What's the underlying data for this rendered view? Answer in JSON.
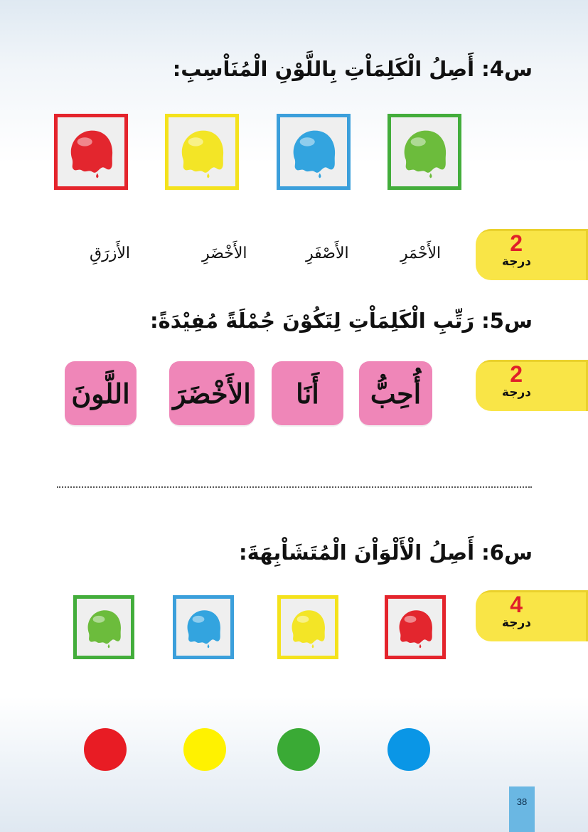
{
  "questions": {
    "q4": {
      "title": "س4: أَصِلُ الْكَلِمَاْتِ بِاللَّوْنِ الْمُنَاْسِبِ:",
      "grade_number": "2",
      "grade_word": "درجة",
      "cards": [
        {
          "color_name": "red",
          "border": "#e4242c",
          "fill": "#e3262e"
        },
        {
          "color_name": "yellow",
          "border": "#f4e21c",
          "fill": "#f3e526"
        },
        {
          "color_name": "blue",
          "border": "#3b9fdb",
          "fill": "#33a4df"
        },
        {
          "color_name": "green",
          "border": "#43ad3b",
          "fill": "#6cbc3c"
        }
      ],
      "words": [
        "الأَزرَقِ",
        "الأَخْضَرِ",
        "الأَصْفَرِ",
        "الأَحْمَرِ"
      ]
    },
    "q5": {
      "title": "س5: رَتِّبِ الْكَلِمَاْتِ لِتَكُوْنَ جُمْلَةً مُفِيْدَةً:",
      "grade_number": "2",
      "grade_word": "درجة",
      "tiles": [
        "اللَّونَ",
        "الأَخْضَرَ",
        "أَنَا",
        "أُحِبُّ"
      ]
    },
    "q6": {
      "title": "س6: أَصِلُ الْأَلْوَاْنَ الْمُتَشَاْبِهَةَ:",
      "grade_number": "4",
      "grade_word": "درجة",
      "cards": [
        {
          "color_name": "green",
          "border": "#43ad3b",
          "fill": "#6cbc3c"
        },
        {
          "color_name": "blue",
          "border": "#3b9fdb",
          "fill": "#33a4df"
        },
        {
          "color_name": "yellow",
          "border": "#f4e21c",
          "fill": "#f3e526"
        },
        {
          "color_name": "red",
          "border": "#e4242c",
          "fill": "#e3262e"
        }
      ],
      "circles": [
        "#e81c24",
        "#fff200",
        "#3aaa35",
        "#0a96e6"
      ]
    }
  },
  "page_number": "38"
}
